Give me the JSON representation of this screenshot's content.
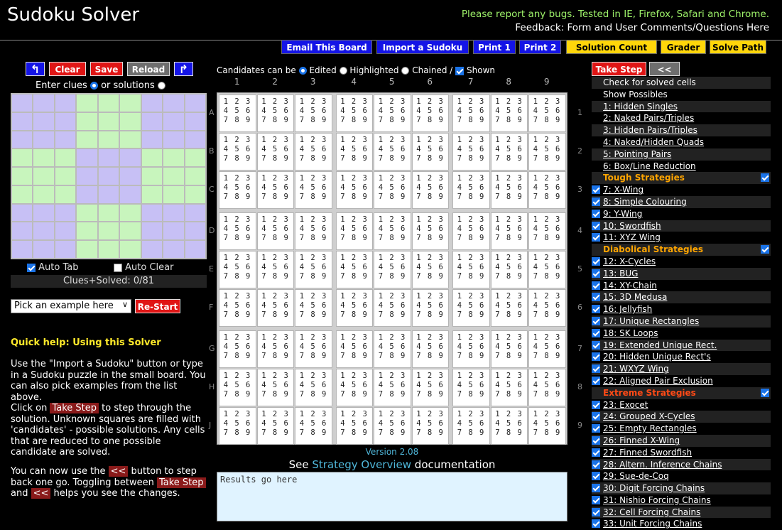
{
  "header": {
    "title": "Sudoku Solver",
    "bugs_notice": "Please report any bugs. Tested in IE, Firefox, Safari and Chrome.",
    "feedback_label": "Feedback:",
    "feedback_link": "Form and User Comments/Questions Here"
  },
  "toolbar": {
    "email": "Email This Board",
    "import": "Import a Sudoku",
    "print1": "Print 1",
    "print2": "Print 2",
    "solution_count": "Solution Count",
    "grader": "Grader",
    "solve_path": "Solve Path"
  },
  "left": {
    "clear": "Clear",
    "save": "Save",
    "reload": "Reload",
    "enter_clues": "Enter clues",
    "or_solutions": "or solutions",
    "auto_tab": "Auto Tab",
    "auto_clear": "Auto Clear",
    "clues_solved": "Clues+Solved: 0/81",
    "example_select": "Pick an example here",
    "restart": "Re-Start"
  },
  "candidates_bar": {
    "prefix": "Candidates can be",
    "edited": "Edited",
    "highlighted": "Highlighted",
    "chained": "Chained /",
    "shown": "Shown"
  },
  "grid": {
    "cols": [
      "1",
      "2",
      "3",
      "4",
      "5",
      "6",
      "7",
      "8",
      "9"
    ],
    "rows": [
      "A",
      "B",
      "C",
      "D",
      "E",
      "F",
      "G",
      "H",
      "J"
    ],
    "candidate_lines": [
      "1 2 3",
      "4 5 6",
      "7 8 9"
    ]
  },
  "version": "Version 2.08",
  "doc_line": {
    "see": "See",
    "link": "Strategy Overview",
    "rest": "documentation"
  },
  "results_placeholder": "Results go here",
  "help": {
    "title": "Quick help: Using this Solver",
    "p1": "Use the \"Import a Sudoku\" button or type in a Sudoku puzzle in the small board. You can also pick examples from the list above.",
    "p2a": "Click on",
    "take_step": "Take Step",
    "p2b": "to step through the solution. Unknown squares are filled with 'candidates' - possible solutions. Any cells that are reduced to one possible candidate are solved.",
    "p3a": "You can now use the",
    "back": "<<",
    "p3b": "button to step back one go. Toggling between",
    "p3c": "and",
    "p3d": "helps you see the changes."
  },
  "right": {
    "take_step": "Take Step",
    "back": "<<",
    "check_solved": "Check for solved cells",
    "show_possibles": "Show Possibles",
    "basic": [
      "1: Hidden Singles",
      "2: Naked Pairs/Triples",
      "3: Hidden Pairs/Triples",
      "4: Naked/Hidden Quads",
      "5: Pointing Pairs",
      "6: Box/Line Reduction"
    ],
    "tough_head": "Tough Strategies",
    "tough": [
      "7: X-Wing",
      "8: Simple Colouring",
      "9: Y-Wing",
      "10: Swordfish",
      "11: XYZ Wing"
    ],
    "diabolical_head": "Diabolical Strategies",
    "diabolical": [
      "12: X-Cycles",
      "13: BUG",
      "14: XY-Chain",
      "15: 3D Medusa",
      "16: Jellyfish",
      "17: Unique Rectangles",
      "18: SK Loops",
      "19: Extended Unique Rect.",
      "20: Hidden Unique Rect's",
      "21: WXYZ Wing",
      "22: Aligned Pair Exclusion"
    ],
    "extreme_head": "Extreme Strategies",
    "extreme": [
      "23: Exocet",
      "24: Grouped X-Cycles",
      "25: Empty Rectangles",
      "26: Finned X-Wing",
      "27: Finned Swordfish",
      "28: Altern. Inference Chains",
      "29: Sue-de-Coq",
      "30: Digit Forcing Chains",
      "31: Nishio Forcing Chains",
      "32: Cell Forcing Chains",
      "33: Unit Forcing Chains"
    ]
  }
}
